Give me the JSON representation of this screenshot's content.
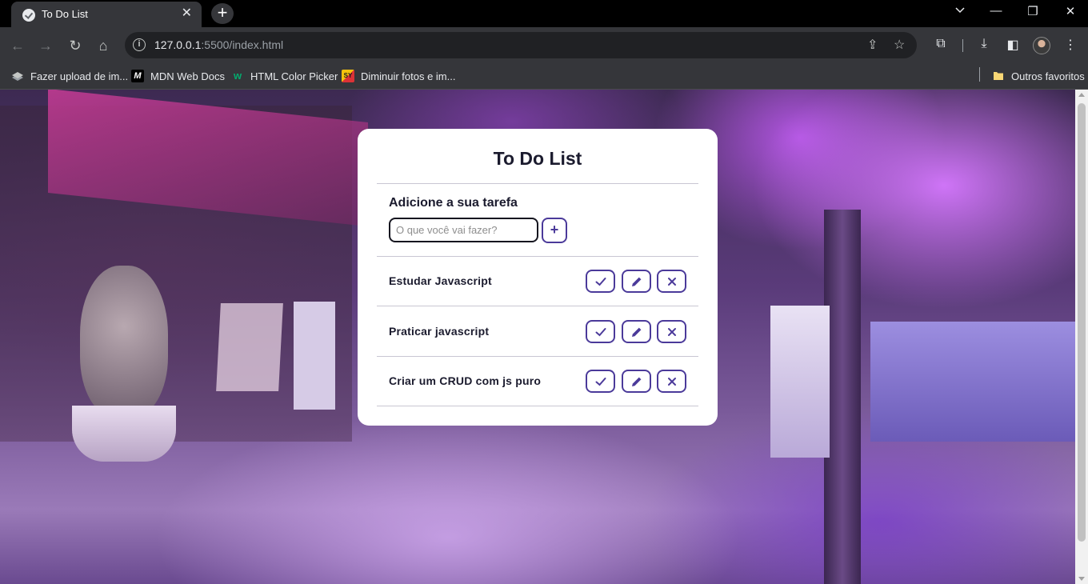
{
  "browser": {
    "tab": {
      "title": "To Do List",
      "close": "✕",
      "favicon": "todo-favicon-icon"
    },
    "new_tab": "+",
    "window_controls": {
      "minimize": "—",
      "restore": "❐",
      "close": "✕"
    },
    "nav": {
      "back": "←",
      "forward": "→",
      "reload": "↻",
      "home": "⌂"
    },
    "address": {
      "host": "127.0.0.1",
      "rest": ":5500/index.html",
      "info_glyph": "i"
    },
    "omnibox_icons": {
      "share": "⇪",
      "bookmark": "☆"
    },
    "toolbar_icons": {
      "extensions": "⧉",
      "downloads": "⤓",
      "sidepanel": "◧",
      "menu": "⋮"
    },
    "bookmarks": [
      {
        "label": "Fazer upload de im...",
        "icon": "upload-icon"
      },
      {
        "label": "MDN Web Docs",
        "icon": "mdn-icon"
      },
      {
        "label": "HTML Color Picker",
        "icon": "w3schools-icon"
      },
      {
        "label": "Diminuir fotos e im...",
        "icon": "resize-icon"
      }
    ],
    "other_bookmarks": "Outros favoritos"
  },
  "todo": {
    "title": "To Do List",
    "add_heading": "Adicione a sua tarefa",
    "input_placeholder": "O que você vai fazer?",
    "add_button": "+",
    "tasks": [
      {
        "text": "Estudar Javascript"
      },
      {
        "text": "Praticar javascript"
      },
      {
        "text": "Criar um CRUD com js puro"
      }
    ]
  },
  "colors": {
    "accent": "#4b3a9a",
    "card_bg": "#ffffff",
    "text": "#1b1b2e"
  }
}
